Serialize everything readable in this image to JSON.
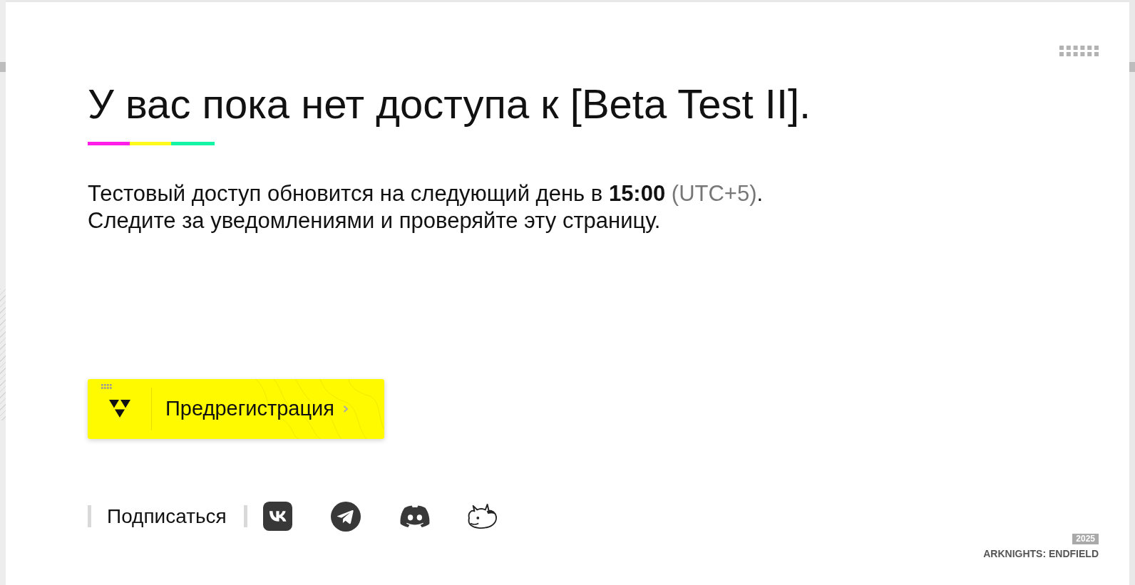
{
  "heading": "У вас пока нет доступа к [Beta Test II].",
  "notice": {
    "line_1": "Тестовый доступ обновится на следующий день в **15:00**",
    "timezone": "(UTC+5)",
    "line_1_end": ".",
    "line_2": "Следите за уведомлениями и проверяйте эту страницу."
  },
  "preregister_button": {
    "label": "Предрегистрация"
  },
  "subscribe": {
    "label": "Подписаться"
  },
  "footer": {
    "year": "2025",
    "title": "ARKNIGHTS: ENDFIELD"
  }
}
